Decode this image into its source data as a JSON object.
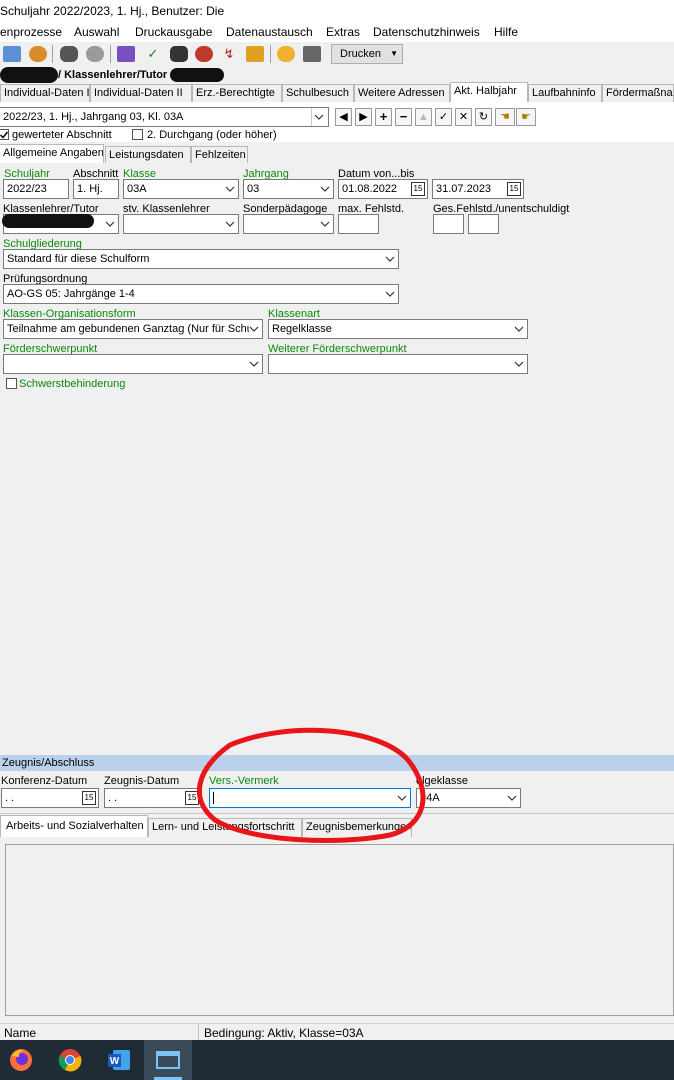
{
  "window": {
    "title": "Schuljahr 2022/2023, 1. Hj., Benutzer: Die"
  },
  "menu": [
    "enprozesse",
    "Auswahl",
    "Druckausgabe",
    "Datenaustausch",
    "Extras",
    "Datenschutzhinweis",
    "Hilfe"
  ],
  "toolbar": {
    "print_label": "Drucken"
  },
  "name_bar": {
    "label": "/ Klassenlehrer/Tutor"
  },
  "tabs": [
    "Individual-Daten I",
    "Individual-Daten II",
    "Erz.-Berechtigte",
    "Schulbesuch",
    "Weitere Adressen",
    "Akt. Halbjahr",
    "Laufbahninfo",
    "Fördermaßnah"
  ],
  "active_tab": "Akt. Halbjahr",
  "period_select": {
    "value": "2022/23, 1. Hj., Jahrgang 03, Kl. 03A"
  },
  "checkboxes": {
    "gewerteter": {
      "label": "gewerteter Abschnitt",
      "checked": true
    },
    "durchgang": {
      "label": "2. Durchgang (oder höher)",
      "checked": false
    }
  },
  "subtabs": [
    "Allgemeine Angaben",
    "Leistungsdaten",
    "Fehlzeiten"
  ],
  "fields": {
    "schuljahr": {
      "label": "Schuljahr",
      "value": "2022/23"
    },
    "abschnitt": {
      "label": "Abschnitt",
      "value": "1. Hj."
    },
    "klasse": {
      "label": "Klasse",
      "value": "03A"
    },
    "jahrgang": {
      "label": "Jahrgang",
      "value": "03"
    },
    "datum": {
      "label": "Datum von...bis",
      "from": "01.08.2022",
      "to": "31.07.2023"
    },
    "klassenlehrer": {
      "label": "Klassenlehrer/Tutor",
      "value": ""
    },
    "stv_klassenlehrer": {
      "label": "stv. Klassenlehrer",
      "value": ""
    },
    "sonderpaedagoge": {
      "label": "Sonderpädagoge",
      "value": ""
    },
    "max_fehlstd": {
      "label": "max. Fehlstd.",
      "value": ""
    },
    "ges_fehlstd": {
      "label": "Ges.Fehlstd./unentschuldigt",
      "value1": "",
      "value2": ""
    },
    "schulgliederung": {
      "label": "Schulgliederung",
      "value": "Standard für diese Schulform"
    },
    "pruefungsordnung": {
      "label": "Prüfungsordnung",
      "value": "AO-GS 05: Jahrgänge 1-4"
    },
    "org_form": {
      "label": "Klassen-Organisationsform",
      "value": "Teilnahme am gebundenen Ganztag (Nur für Schu"
    },
    "klassenart": {
      "label": "Klassenart",
      "value": "Regelklasse"
    },
    "foerderschwerpunkt": {
      "label": "Förderschwerpunkt",
      "value": ""
    },
    "weiterer_foerder": {
      "label": "Weiterer Förderschwerpunkt",
      "value": ""
    },
    "schwerstbehinderung": {
      "label": "Schwerstbehinderung",
      "checked": false
    }
  },
  "zeugnis": {
    "header": "Zeugnis/Abschluss",
    "konferenz": {
      "label": "Konferenz-Datum",
      "value": " .  ."
    },
    "zeugnisdatum": {
      "label": "Zeugnis-Datum",
      "value": " .  ."
    },
    "vermerk": {
      "label": "Vers.-Vermerk",
      "value": ""
    },
    "folgeklasse": {
      "label": "olgeklasse",
      "value": "04A"
    }
  },
  "bottom_tabs": [
    "Arbeits- und Sozialverhalten",
    "Lern- und Leistungsfortschritt",
    "Zeugnisbemerkungen"
  ],
  "status": {
    "name": "Name",
    "condition": "Bedingung: Aktiv, Klasse=03A"
  },
  "colors": {
    "accent_green": "#0a8a0a",
    "section_blue": "#b9d1ea",
    "annotation_red": "#e8151b",
    "taskbar": "#1f2c36"
  }
}
